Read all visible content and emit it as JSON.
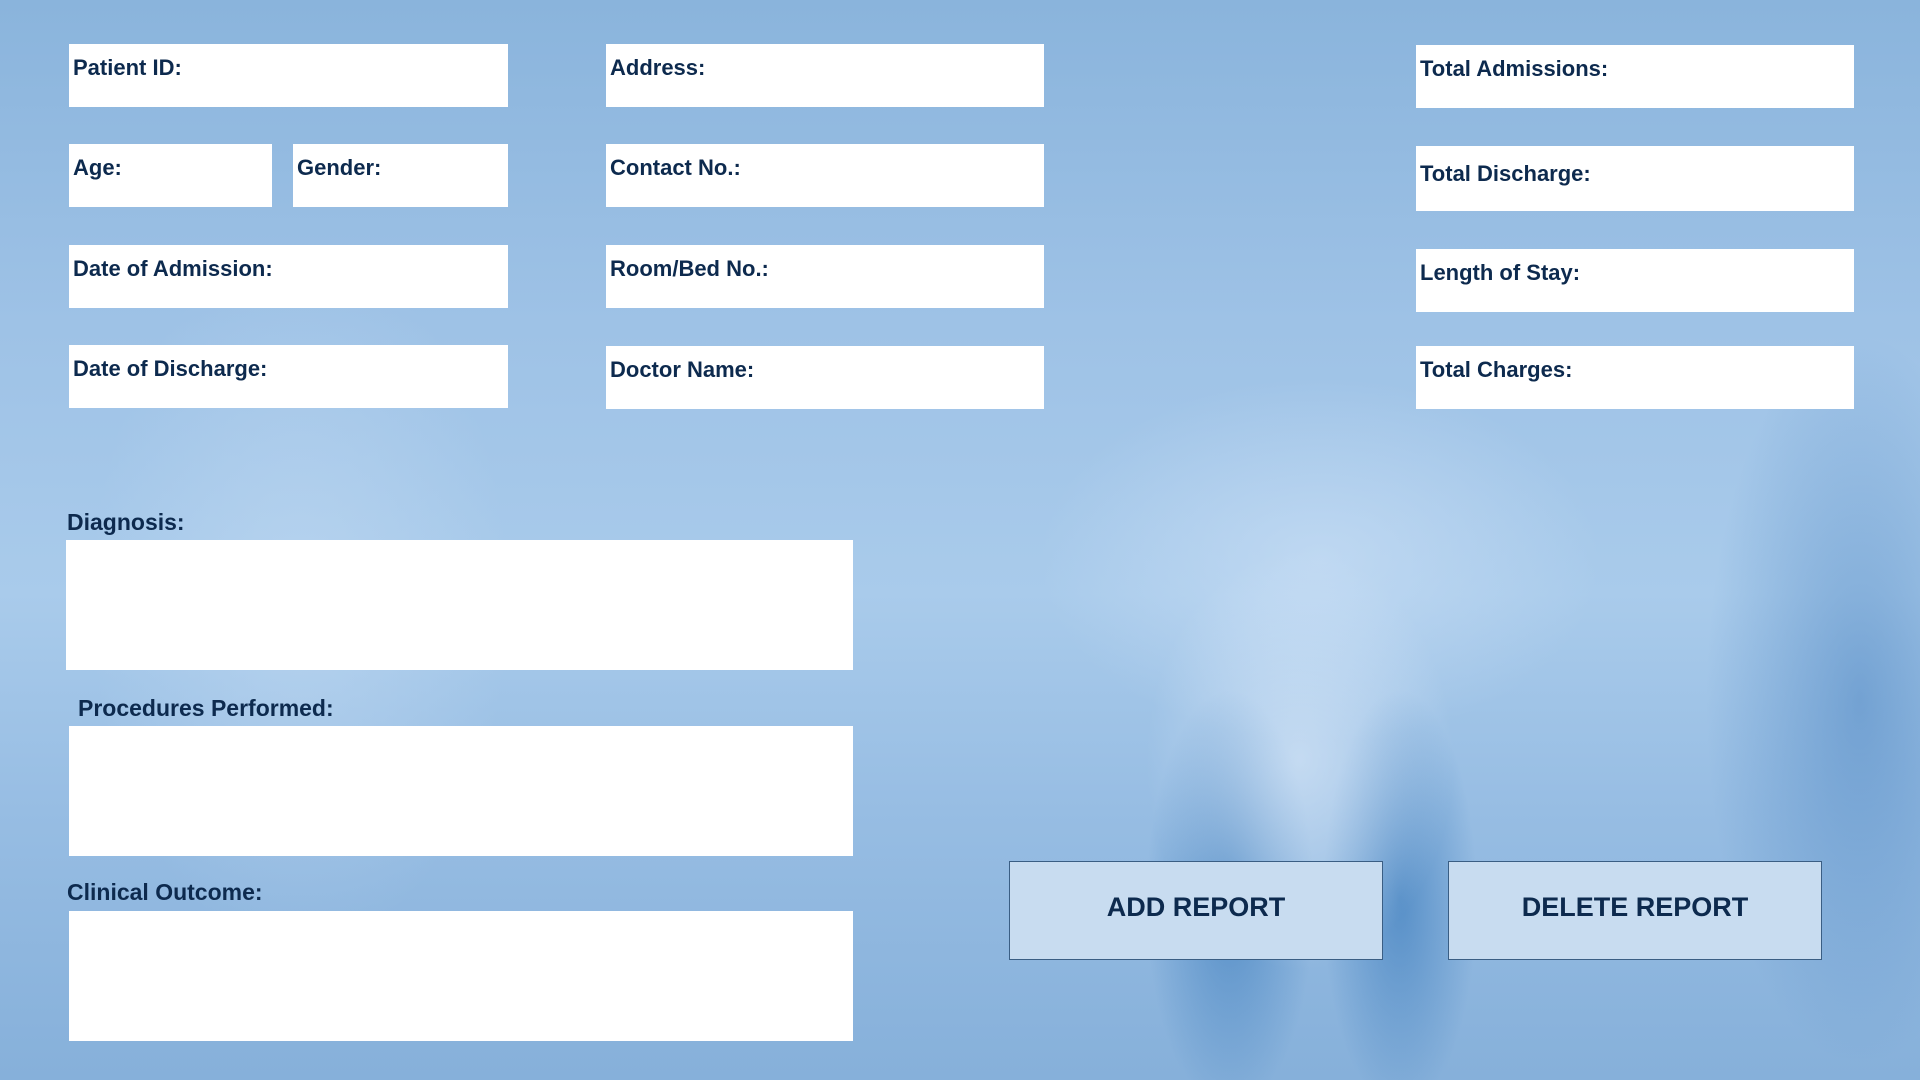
{
  "left_fields": {
    "patient_id": {
      "label": "Patient ID:",
      "value": ""
    },
    "age": {
      "label": "Age:",
      "value": ""
    },
    "gender": {
      "label": "Gender:",
      "value": ""
    },
    "date_of_admission": {
      "label": "Date of Admission:",
      "value": ""
    },
    "date_of_discharge": {
      "label": "Date of Discharge:",
      "value": ""
    }
  },
  "middle_fields": {
    "address": {
      "label": "Address:",
      "value": ""
    },
    "contact_no": {
      "label": "Contact No.:",
      "value": ""
    },
    "room_bed_no": {
      "label": "Room/Bed No.:",
      "value": ""
    },
    "doctor_name": {
      "label": "Doctor Name:",
      "value": ""
    }
  },
  "right_fields": {
    "total_admissions": {
      "label": "Total Admissions:",
      "value": ""
    },
    "total_discharge": {
      "label": "Total Discharge:",
      "value": ""
    },
    "length_of_stay": {
      "label": "Length of Stay:",
      "value": ""
    },
    "total_charges": {
      "label": "Total Charges:",
      "value": ""
    }
  },
  "sections": {
    "diagnosis": {
      "label": "Diagnosis:",
      "value": ""
    },
    "procedures_performed": {
      "label": "Procedures Performed:",
      "value": ""
    },
    "clinical_outcome": {
      "label": "Clinical Outcome:",
      "value": ""
    }
  },
  "buttons": {
    "add_report": "ADD REPORT",
    "delete_report": "DELETE REPORT"
  },
  "colors": {
    "text": "#0d2a4e",
    "field_background": "#ffffff",
    "button_background": "#c8dcf0",
    "background_blue": "#9ec2e6"
  }
}
